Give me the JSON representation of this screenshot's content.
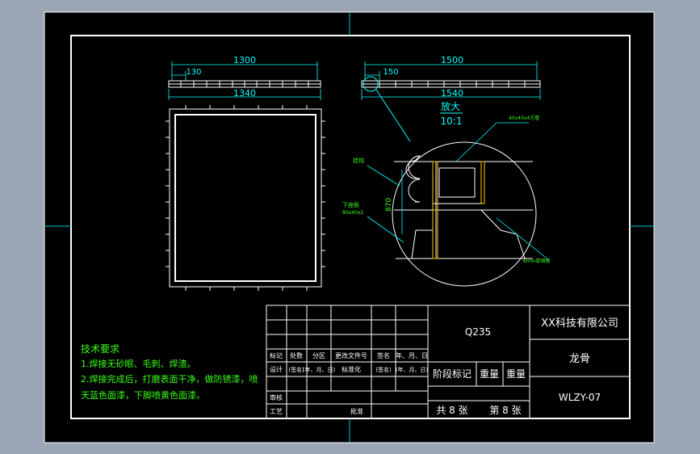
{
  "colors": {
    "background": "#9aa5b5",
    "sheet": "#000000",
    "line": "#ffffff",
    "dimension": "#00ffff",
    "annotation": "#39ff14"
  },
  "top_view": {
    "overall_dim": "1300",
    "offset_dim": "130",
    "bottom_dim": "1340"
  },
  "side_view": {
    "overall_dim": "1500",
    "offset_dim": "150",
    "bottom_dim": "1540"
  },
  "detail": {
    "label": "放大",
    "scale": "10:1",
    "tube_label": "40x40x4方管",
    "hook_label": "挂钩",
    "lower_beam_label": "下座板",
    "lower_beam_size": "80x40x2",
    "height_dim": "870",
    "plate_label": "6mm厚钢板"
  },
  "tech_requirements": {
    "title": "技术要求",
    "line1": "1.焊接无砂眼、毛刺、焊渣。",
    "line2": "2.焊接完成后，打磨表面干净，做防锈漆，喷",
    "line3": "天蓝色面漆，下脚喷黄色面漆。"
  },
  "title_block": {
    "material": "Q235",
    "company": "XX科技有限公司",
    "part_name": "龙骨",
    "drawing_no": "WLZY-07",
    "header_cols": [
      "标记",
      "处数",
      "分区",
      "更改文件号",
      "签名",
      "年、月、日"
    ],
    "design_label": "设计",
    "signature": "(签名)",
    "date_label": "(年、月、日)",
    "standard_label": "标准化",
    "signature2": "(签名)",
    "date_label2": "(年、月、日)",
    "stage_label": "阶段标记",
    "weight_label": "重量",
    "scale_label": "重量",
    "review_label": "审核",
    "process_label": "工艺",
    "approve_label": "批准",
    "total_sheets": "共 8 张",
    "sheet_no": "第 8 张"
  }
}
